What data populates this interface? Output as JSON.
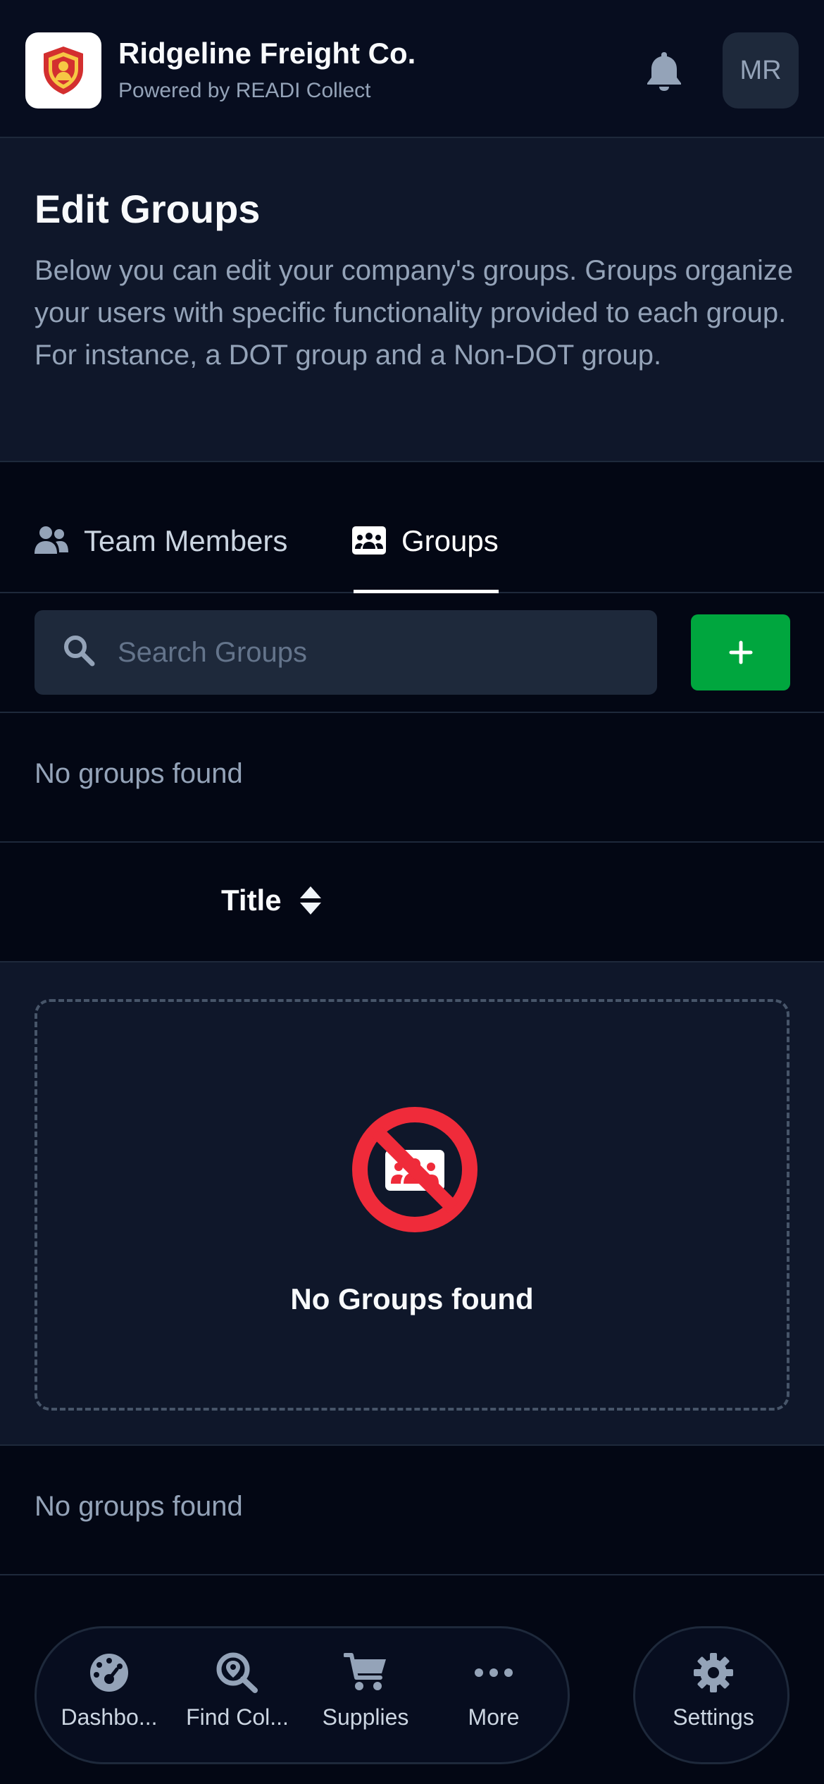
{
  "header": {
    "company_name": "Ridgeline Freight Co.",
    "powered_by": "Powered by READI Collect",
    "avatar_initials": "MR"
  },
  "intro": {
    "title": "Edit Groups",
    "description": "Below you can edit your company's groups. Groups organize your users with specific functionality provided to each group. For instance, a DOT group and a Non-DOT group."
  },
  "tabs": [
    {
      "label": "Team Members",
      "icon": "users-icon",
      "active": false
    },
    {
      "label": "Groups",
      "icon": "groups-card-icon",
      "active": true
    }
  ],
  "search": {
    "placeholder": "Search Groups",
    "value": ""
  },
  "status_top": "No groups found",
  "table": {
    "column_title": "Title"
  },
  "empty_state": {
    "message": "No Groups found",
    "icon": "no-groups-icon"
  },
  "status_bottom": "No groups found",
  "bottom_nav": {
    "items": [
      {
        "label": "Dashbo...",
        "icon": "dashboard-gauge-icon"
      },
      {
        "label": "Find Col...",
        "icon": "find-location-icon"
      },
      {
        "label": "Supplies",
        "icon": "cart-icon"
      },
      {
        "label": "More",
        "icon": "more-dots-icon"
      }
    ],
    "settings_label": "Settings"
  },
  "colors": {
    "background": "#030714",
    "panel": "#0f172a",
    "accent_green": "#00a63e",
    "danger_red": "#ef2b3a",
    "text_muted": "#94a3b8"
  }
}
